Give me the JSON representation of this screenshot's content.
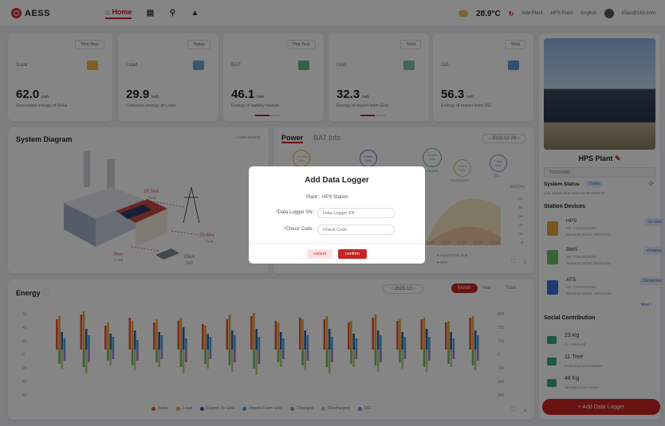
{
  "header": {
    "brand": "AESS",
    "nav_home": "Home",
    "temperature": "28.9°C",
    "add_plant": "Add Plant",
    "plant_select": "HPS Plant",
    "language": "English",
    "user": "Elias@163.com"
  },
  "stats": [
    {
      "period": "This Year",
      "name": "Solar",
      "value": "62.0",
      "unit": "kwh",
      "desc": "Generated energy of Solar"
    },
    {
      "period": "Today",
      "name": "Load",
      "value": "29.9",
      "unit": "kwh",
      "desc": "Consume energy of Load"
    },
    {
      "period": "This Year",
      "name": "BAT",
      "value": "46.1",
      "unit": "kwh",
      "desc": "Energy of battery charge"
    },
    {
      "period": "Total",
      "name": "Grid",
      "value": "32.3",
      "unit": "kwh",
      "desc": "Energy of import from Grid"
    },
    {
      "period": "Total",
      "name": "DG",
      "value": "56.3",
      "unit": "kwh",
      "desc": "Energy of import from DG"
    }
  ],
  "diagram": {
    "title": "System Diagram",
    "mode": "Load priority",
    "grid_power": "26.5kw",
    "grid_label": "Grid",
    "solar_power": "20.6kw",
    "solar_label": "Grid",
    "load_power": "8kw",
    "load_label": "Load",
    "bat_power": "25kw",
    "bat_label": "BAT"
  },
  "power": {
    "tab_power": "Power",
    "tab_bat": "BAT Info",
    "date": "2022-12-28",
    "nodes": [
      {
        "v": "120.0kw",
        "s": "Max"
      },
      {
        "v": "5.0kw",
        "s": "Max"
      },
      {
        "v": "12.0kw",
        "s": "Max"
      },
      {
        "v": "3.0kw",
        "s": "Max"
      },
      {
        "v": "7.0kw",
        "s": "Max"
      }
    ],
    "node_labels": [
      "",
      "Charged",
      "Discharged",
      "DG"
    ],
    "soc_label": "SOC(%)",
    "axis_right": [
      "100",
      "80",
      "60",
      "40",
      "20",
      "0"
    ],
    "axis_x": [
      "16:00",
      "18:00",
      "20:00",
      "22:00",
      "24:00"
    ],
    "legend": [
      "Import From Grid",
      "SOC"
    ]
  },
  "energy": {
    "title": "Energy",
    "month": "2022-10",
    "tab_month": "Month",
    "tab_year": "Year",
    "tab_total": "Total",
    "left_axis": [
      "60",
      "40",
      "20",
      "0",
      "20",
      "40",
      "60"
    ],
    "right_axis": [
      "300",
      "200",
      "100",
      "0",
      "100",
      "200",
      "300"
    ],
    "legend": [
      "Solar",
      "Load",
      "Export To Grid",
      "Import From Grid",
      "Charged",
      "Discharged",
      "DG"
    ],
    "legend_colors": [
      "#e8552e",
      "#e8a33a",
      "#2e5fa8",
      "#3fa5dc",
      "#6abf69",
      "#c5c98a",
      "#9a7fd1"
    ]
  },
  "plant": {
    "name": "HPS Plant",
    "search_placeholder": "TOGO0989",
    "status_label": "System Status",
    "status": "Online",
    "last_update": "Last update time:2023-10-08 10:08:08",
    "devices_title": "Station Devices",
    "devices": [
      {
        "name": "HPS",
        "sn": "SN: TOGOO18080",
        "warranty": "Warranty period: 2023/12/31",
        "badge": "On-Grid",
        "color": "#e8a33a"
      },
      {
        "name": "BMS",
        "sn": "SN: TOGOO18080",
        "warranty": "Warranty period: 2023/12/31",
        "badge": "charging",
        "color": "#6abf69"
      },
      {
        "name": "ATS",
        "sn": "SN: TOGOO18080",
        "warranty": "Warranty period: 2023/12/31",
        "badge": "Connected",
        "color": "#3a6fd8"
      }
    ],
    "more": "More",
    "social_title": "Social Contribution",
    "social": [
      {
        "value": "23 Kg",
        "label": "Co, Reduced",
        "color": "#3aa88a"
      },
      {
        "value": "11 Tree",
        "label": "Reducing Deforestation",
        "color": "#3aa88a"
      },
      {
        "value": "48 Kg",
        "label": "Standard Coal Saved",
        "color": "#3aa88a"
      }
    ],
    "add_logger": "+ Add Data Logger"
  },
  "modal": {
    "title": "Add Data Logger",
    "plant_label": "Plant :",
    "plant_value": "HPS Station",
    "sn_label": "Data Logger SN :",
    "sn_placeholder": "Data Logger SN",
    "code_label": "Check Code :",
    "code_placeholder": "Check Code",
    "cancel": "cancel",
    "confirm": "confirm"
  }
}
